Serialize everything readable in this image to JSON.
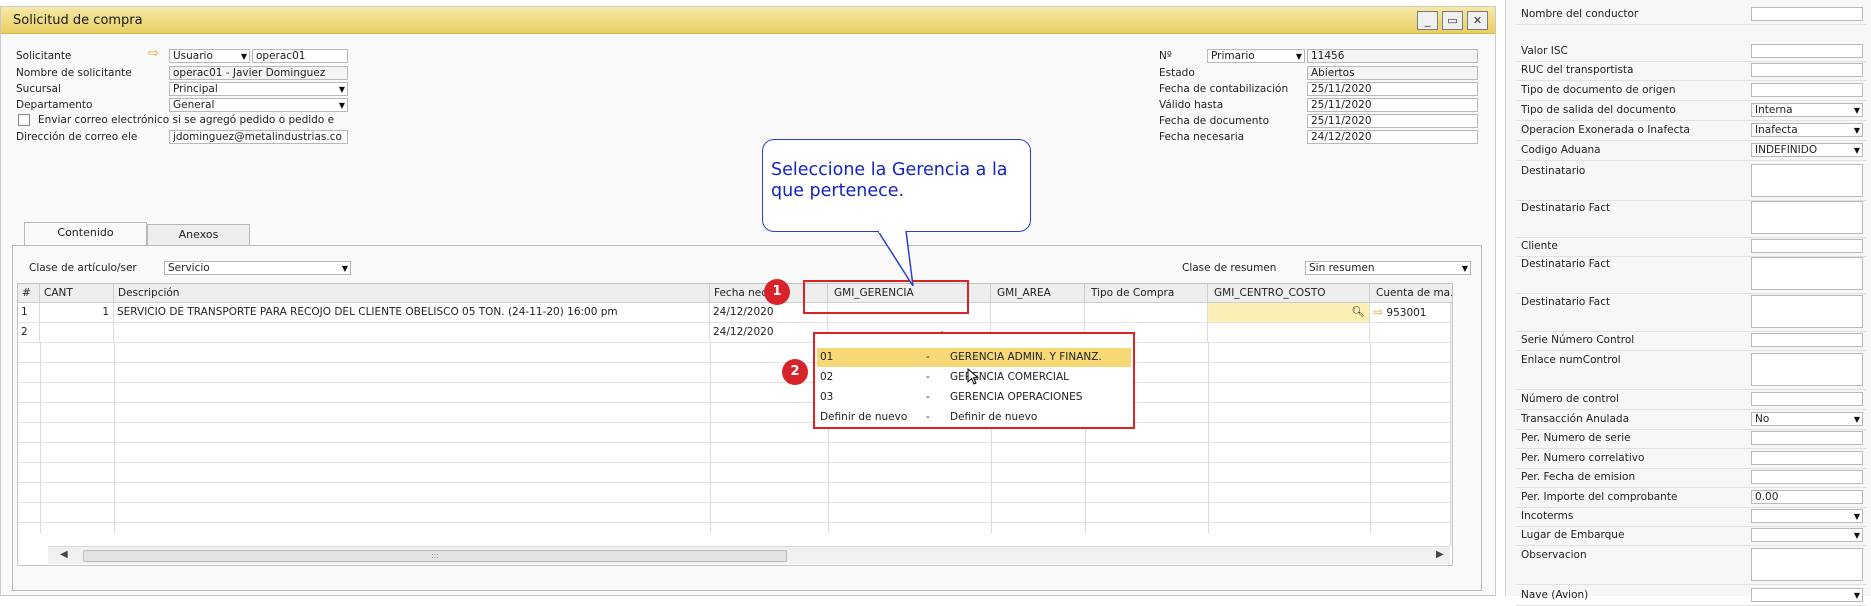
{
  "window": {
    "title": "Solicitud de compra",
    "min": "_",
    "restore": "▭",
    "close": "✕"
  },
  "header_left": {
    "solicitante_label": "Solicitante",
    "solicitante_type": "Usuario",
    "solicitante_value": "operac01",
    "nombre_label": "Nombre de solicitante",
    "nombre_value": "operac01 - Javier Dominguez",
    "sucursal_label": "Sucursal",
    "sucursal_value": "Principal",
    "departamento_label": "Departamento",
    "departamento_value": "General",
    "email_check_label": "Enviar correo electrónico si se agregó pedido o pedido e",
    "email_label": "Dirección de correo ele",
    "email_value": "jdominguez@metalindustrias.co"
  },
  "header_right": {
    "no_label": "Nº",
    "serie_value": "Primario",
    "no_value": "11456",
    "estado_label": "Estado",
    "estado_value": "Abiertos",
    "fecha_cont_label": "Fecha de contabilización",
    "fecha_cont_value": "25/11/2020",
    "valido_label": "Válido hasta",
    "valido_value": "25/11/2020",
    "fecha_doc_label": "Fecha de documento",
    "fecha_doc_value": "25/11/2020",
    "fecha_nec_label": "Fecha necesaria",
    "fecha_nec_value": "24/12/2020"
  },
  "tabs": [
    {
      "label": "Contenido"
    },
    {
      "label": "Anexos"
    }
  ],
  "content": {
    "clase_label": "Clase de artículo/ser",
    "clase_value": "Servicio",
    "resumen_label": "Clase de resumen",
    "resumen_value": "Sin resumen"
  },
  "grid": {
    "headers": [
      "#",
      "CANT",
      "Descripción",
      "Fecha neces",
      "GMI_GERENCIA",
      "GMI_AREA",
      "Tipo de Compra",
      "GMI_CENTRO_COSTO",
      "Cuenta de ma..."
    ],
    "rows": [
      {
        "num": "1",
        "cant": "1",
        "desc": "SERVICIO DE TRANSPORTE PARA RECOJO DEL CLIENTE OBELISCO 05 TON. (24-11-20) 16:00 pm",
        "fecha": "24/12/2020",
        "gerencia": "",
        "area": "",
        "tipo": "",
        "centro": "",
        "cuenta": "953001"
      },
      {
        "num": "2",
        "cant": "",
        "desc": "",
        "fecha": "24/12/2020",
        "gerencia": "-",
        "area": "",
        "tipo": "",
        "centro": "",
        "cuenta": ""
      }
    ],
    "scroll_marker": ":::"
  },
  "dropdown": {
    "options": [
      {
        "code": "01",
        "sep": "-",
        "name": "GERENCIA ADMIN. Y FINANZ."
      },
      {
        "code": "02",
        "sep": "-",
        "name": "GERENCIA COMERCIAL"
      },
      {
        "code": "03",
        "sep": "-",
        "name": "GERENCIA OPERACIONES"
      },
      {
        "code": "Definir de nuevo",
        "sep": "-",
        "name": "Definir de nuevo"
      }
    ]
  },
  "annotations": {
    "callout": "Seleccione la Gerencia a la que pertenece.",
    "badge1": "1",
    "badge2": "2"
  },
  "side": {
    "items": [
      {
        "label": "Nombre del conductor",
        "value": ""
      },
      {
        "label": "Valor ISC",
        "value": ""
      },
      {
        "label": "RUC del transportista",
        "value": ""
      },
      {
        "label": "Tipo de documento de origen",
        "value": ""
      },
      {
        "label": "Tipo de salida del documento",
        "value": "Interna"
      },
      {
        "label": "Operacion Exonerada o Inafecta",
        "value": "Inafecta"
      },
      {
        "label": "Codigo Aduana",
        "value": "INDEFINIDO"
      },
      {
        "label": "Destinatario",
        "value": ""
      },
      {
        "label": "Destinatario Fact",
        "value": ""
      },
      {
        "label": "Cliente",
        "value": ""
      },
      {
        "label": "Destinatario Fact",
        "value": ""
      },
      {
        "label": "Destinatario Fact",
        "value": ""
      },
      {
        "label": "Serie Número Control",
        "value": ""
      },
      {
        "label": "Enlace numControl",
        "value": ""
      },
      {
        "label": "Número de control",
        "value": ""
      },
      {
        "label": "Transacción Anulada",
        "value": "No"
      },
      {
        "label": "Per. Numero de serie",
        "value": ""
      },
      {
        "label": "Per. Numero correlativo",
        "value": ""
      },
      {
        "label": "Per. Fecha de emision",
        "value": ""
      },
      {
        "label": "Per. Importe del comprobante",
        "value": "0.00"
      },
      {
        "label": "Incoterms",
        "value": ""
      },
      {
        "label": "Lugar de Embarque",
        "value": ""
      },
      {
        "label": "Observacion",
        "value": ""
      },
      {
        "label": "Nave (Avion)",
        "value": ""
      }
    ]
  },
  "colors": {
    "title_bar": "#e9cf63",
    "highlight": "#f6d877",
    "red": "#d9232b",
    "callout_blue": "#1424c0",
    "arrow": "#e8a21a"
  }
}
